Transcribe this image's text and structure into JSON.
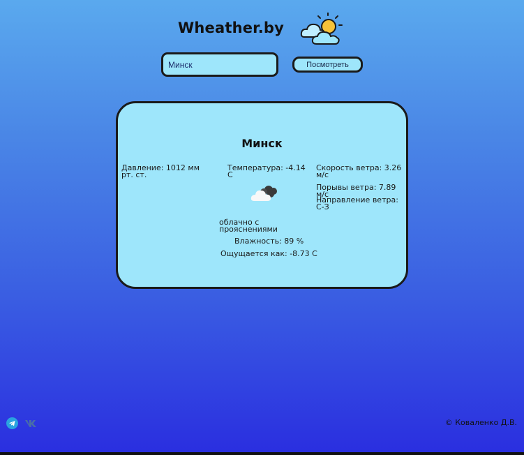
{
  "header": {
    "brand": "Wheather.by",
    "logo_icon": "sun-behind-clouds-icon"
  },
  "search": {
    "value": "Минск",
    "button_label": "Посмотреть"
  },
  "weather": {
    "city": "Минск",
    "pressure": "Давление: 1012 мм рт. ст.",
    "temperature": "Температура: -4.14 C",
    "wind_speed": "Скорость ветра: 3.26 м/с",
    "wind_gusts": "Порывы ветра: 7.89 м/с",
    "wind_direction": "Направление ветра: С-З",
    "condition_icon": "cloudy-icon",
    "description": "облачно с прояснениями",
    "humidity": "Влажность: 89 %",
    "feels_like": "Ощущается как: -8.73 C"
  },
  "footer": {
    "socials": [
      {
        "name": "telegram-icon",
        "color": "#2aa3e0"
      },
      {
        "name": "vk-icon",
        "color": "#4a6ea8"
      }
    ],
    "copyright": "© Коваленко Д.В."
  },
  "colors": {
    "card": "#9ee6fb",
    "border": "#1a1a1a",
    "bg_top": "#5aa9ee",
    "bg_bottom": "#2a2ee0"
  }
}
